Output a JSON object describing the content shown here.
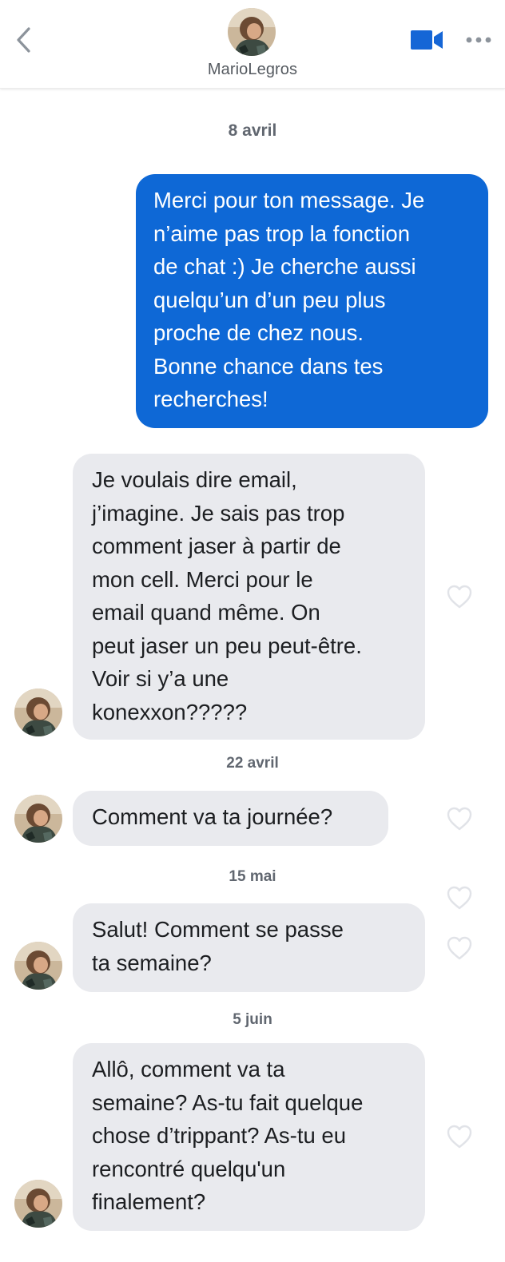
{
  "header": {
    "contact_name": "MarioLegros",
    "icons": {
      "back": "chevron-left-icon",
      "video": "video-camera-icon",
      "more": "more-options-icon"
    }
  },
  "colors": {
    "accent": "#0e68d6",
    "incoming_bubble": "#e9eaee",
    "date_text": "#616770"
  },
  "dates": {
    "d1": "8 avril",
    "d2": "22 avril",
    "d3": "15 mai",
    "d4": "5 juin"
  },
  "messages": [
    {
      "direction": "outgoing",
      "lines": [
        "Merci pour ton message. Je",
        "n’aime pas trop la fonction",
        "de chat :) Je cherche aussi",
        "quelqu’un d’un peu plus",
        "proche de chez nous.",
        "Bonne chance dans tes",
        "recherches!"
      ]
    },
    {
      "direction": "incoming",
      "lines": [
        "Je voulais dire email,",
        "j’imagine. Je sais pas trop",
        "comment jaser à partir de",
        "mon cell. Merci pour le",
        "email quand même. On",
        "peut jaser un peu peut-être.",
        "Voir si y’a une",
        "konexxon?????"
      ]
    },
    {
      "direction": "incoming",
      "lines": [
        "Comment va ta journée?"
      ]
    },
    {
      "direction": "incoming",
      "lines": [
        "Salut! Comment se passe",
        "ta semaine?"
      ]
    },
    {
      "direction": "incoming",
      "lines": [
        "Allô, comment va ta",
        "semaine? As-tu fait quelque",
        "chose d’trippant? As-tu eu",
        "rencontré quelqu'un",
        "finalement?"
      ]
    }
  ]
}
